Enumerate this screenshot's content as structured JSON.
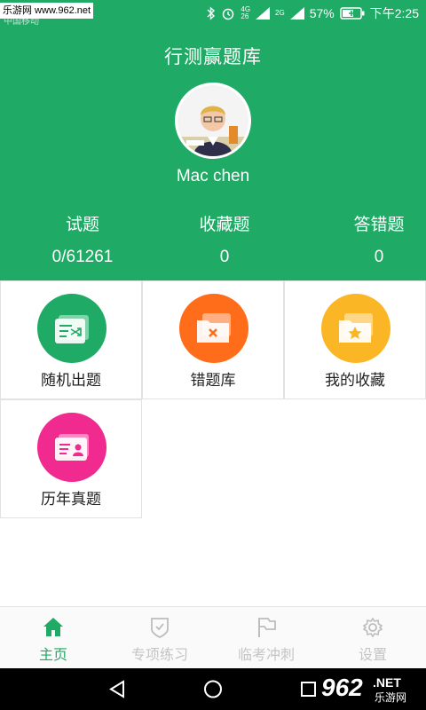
{
  "status_bar": {
    "watermark": "乐游网 www.962.net",
    "carrier": "中国移动",
    "network_top": "4G",
    "network_bottom": "26",
    "network2": "2G",
    "battery": "57%",
    "time": "下午2:25"
  },
  "header": {
    "app_title": "行测赢题库",
    "username": "Mac chen",
    "stats": [
      {
        "label": "试题",
        "value": "0/61261"
      },
      {
        "label": "收藏题",
        "value": "0"
      },
      {
        "label": "答错题",
        "value": "0"
      }
    ]
  },
  "tiles": [
    {
      "label": "随机出题",
      "color": "#1faa65",
      "icon": "shuffle-card-icon"
    },
    {
      "label": "错题库",
      "color": "#ff6d1a",
      "icon": "wrong-folder-icon"
    },
    {
      "label": "我的收藏",
      "color": "#fbb626",
      "icon": "star-folder-icon"
    },
    {
      "label": "历年真题",
      "color": "#f02a8f",
      "icon": "id-card-icon"
    }
  ],
  "bottom_nav": [
    {
      "label": "主页",
      "icon": "home-icon",
      "active": true
    },
    {
      "label": "专项练习",
      "icon": "shield-check-icon",
      "active": false
    },
    {
      "label": "临考冲刺",
      "icon": "flag-icon",
      "active": false
    },
    {
      "label": "设置",
      "icon": "gear-icon",
      "active": false
    }
  ],
  "colors": {
    "brand_green": "#1faa65",
    "inactive_gray": "#c4c4c4"
  },
  "watermark_logo": {
    "number": "962",
    "suffix": ".NET",
    "caption": "乐游网"
  }
}
